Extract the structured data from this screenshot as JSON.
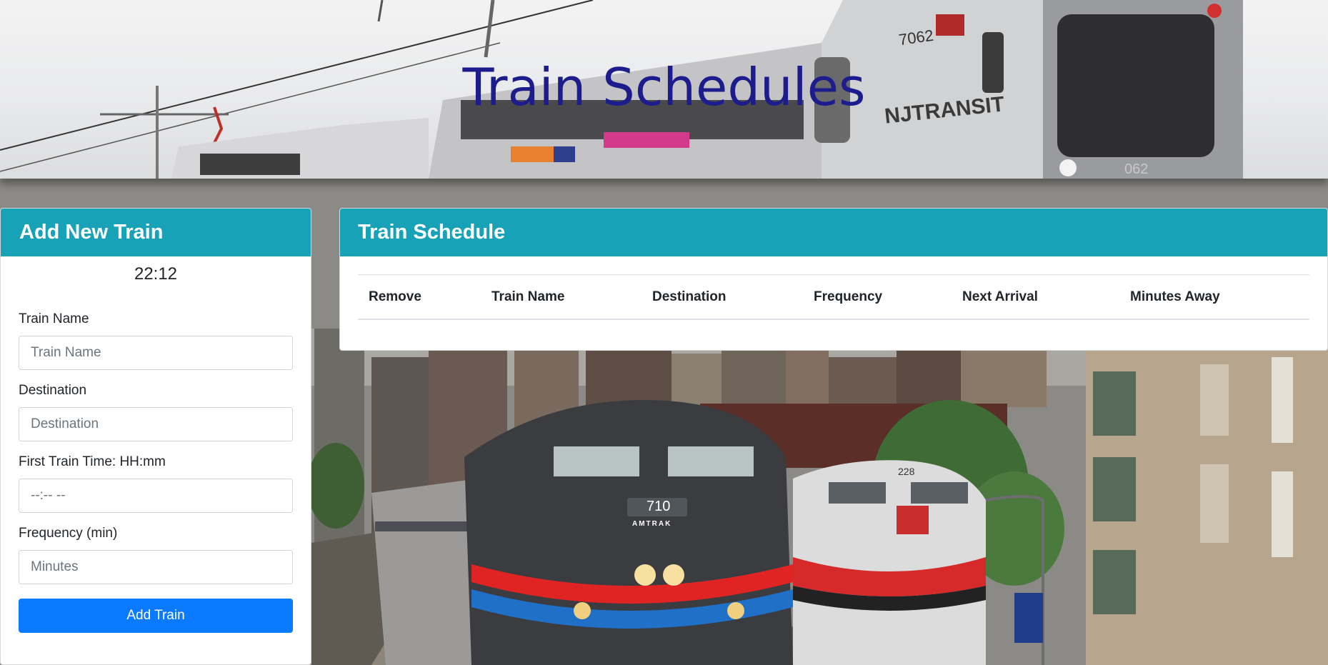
{
  "header": {
    "title": "Train Schedules",
    "banner_train_number": "7062",
    "banner_operator_text": "NJTRANSIT",
    "banner_nose_number": "062"
  },
  "add_train": {
    "heading": "Add New Train",
    "clock": "22:12",
    "fields": [
      {
        "label": "Train Name",
        "placeholder": "Train Name",
        "value": ""
      },
      {
        "label": "Destination",
        "placeholder": "Destination",
        "value": ""
      },
      {
        "label": "First Train Time: HH:mm",
        "placeholder": "--:-- --",
        "value": ""
      },
      {
        "label": "Frequency (min)",
        "placeholder": "Minutes",
        "value": ""
      }
    ],
    "submit_label": "Add Train"
  },
  "schedule": {
    "heading": "Train Schedule",
    "columns": [
      "Remove",
      "Train Name",
      "Destination",
      "Frequency",
      "Next Arrival",
      "Minutes Away"
    ],
    "rows": []
  },
  "background": {
    "loco_left_number": "710",
    "loco_left_brand": "AMTRAK",
    "loco_right_number": "228"
  },
  "colors": {
    "card_header": "#17a2b8",
    "primary_button": "#0a7bff",
    "title_text": "#1c1c8c"
  }
}
